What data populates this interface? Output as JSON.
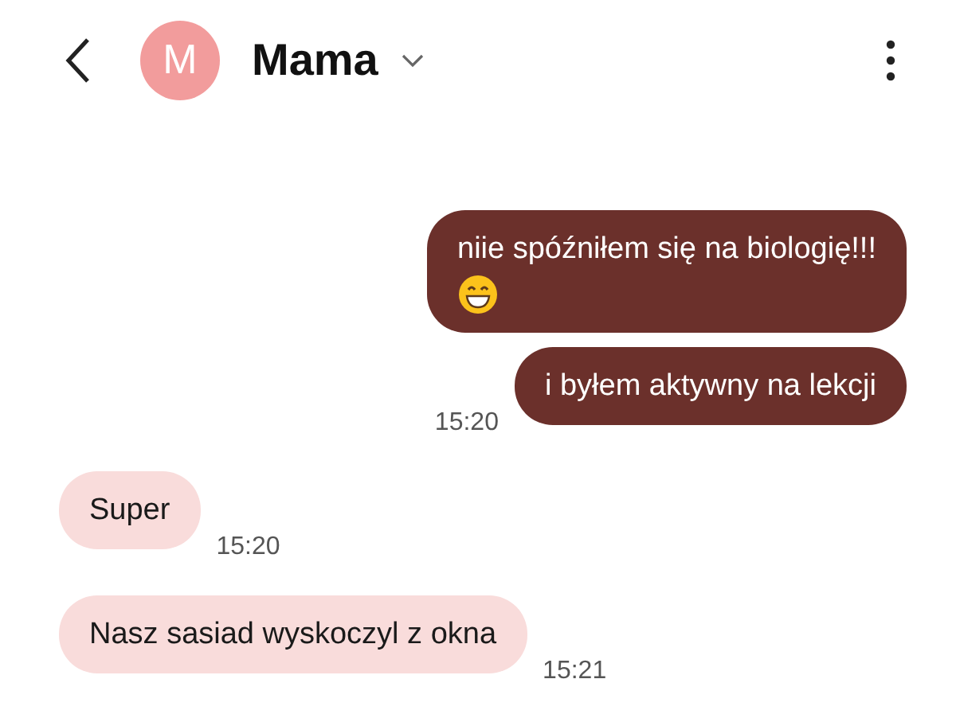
{
  "contact": {
    "name": "Mama",
    "initial": "M"
  },
  "messages": [
    {
      "kind": "sent",
      "text": "niie spóźniłem się na biologię!!!",
      "emoji": true
    },
    {
      "kind": "sent",
      "text": "i byłem aktywny na lekcji",
      "time": "15:20"
    },
    {
      "kind": "received",
      "text": "Super",
      "time": "15:20"
    },
    {
      "kind": "received",
      "text": "Nasz sasiad wyskoczyl z okna",
      "time": "15:21"
    }
  ]
}
